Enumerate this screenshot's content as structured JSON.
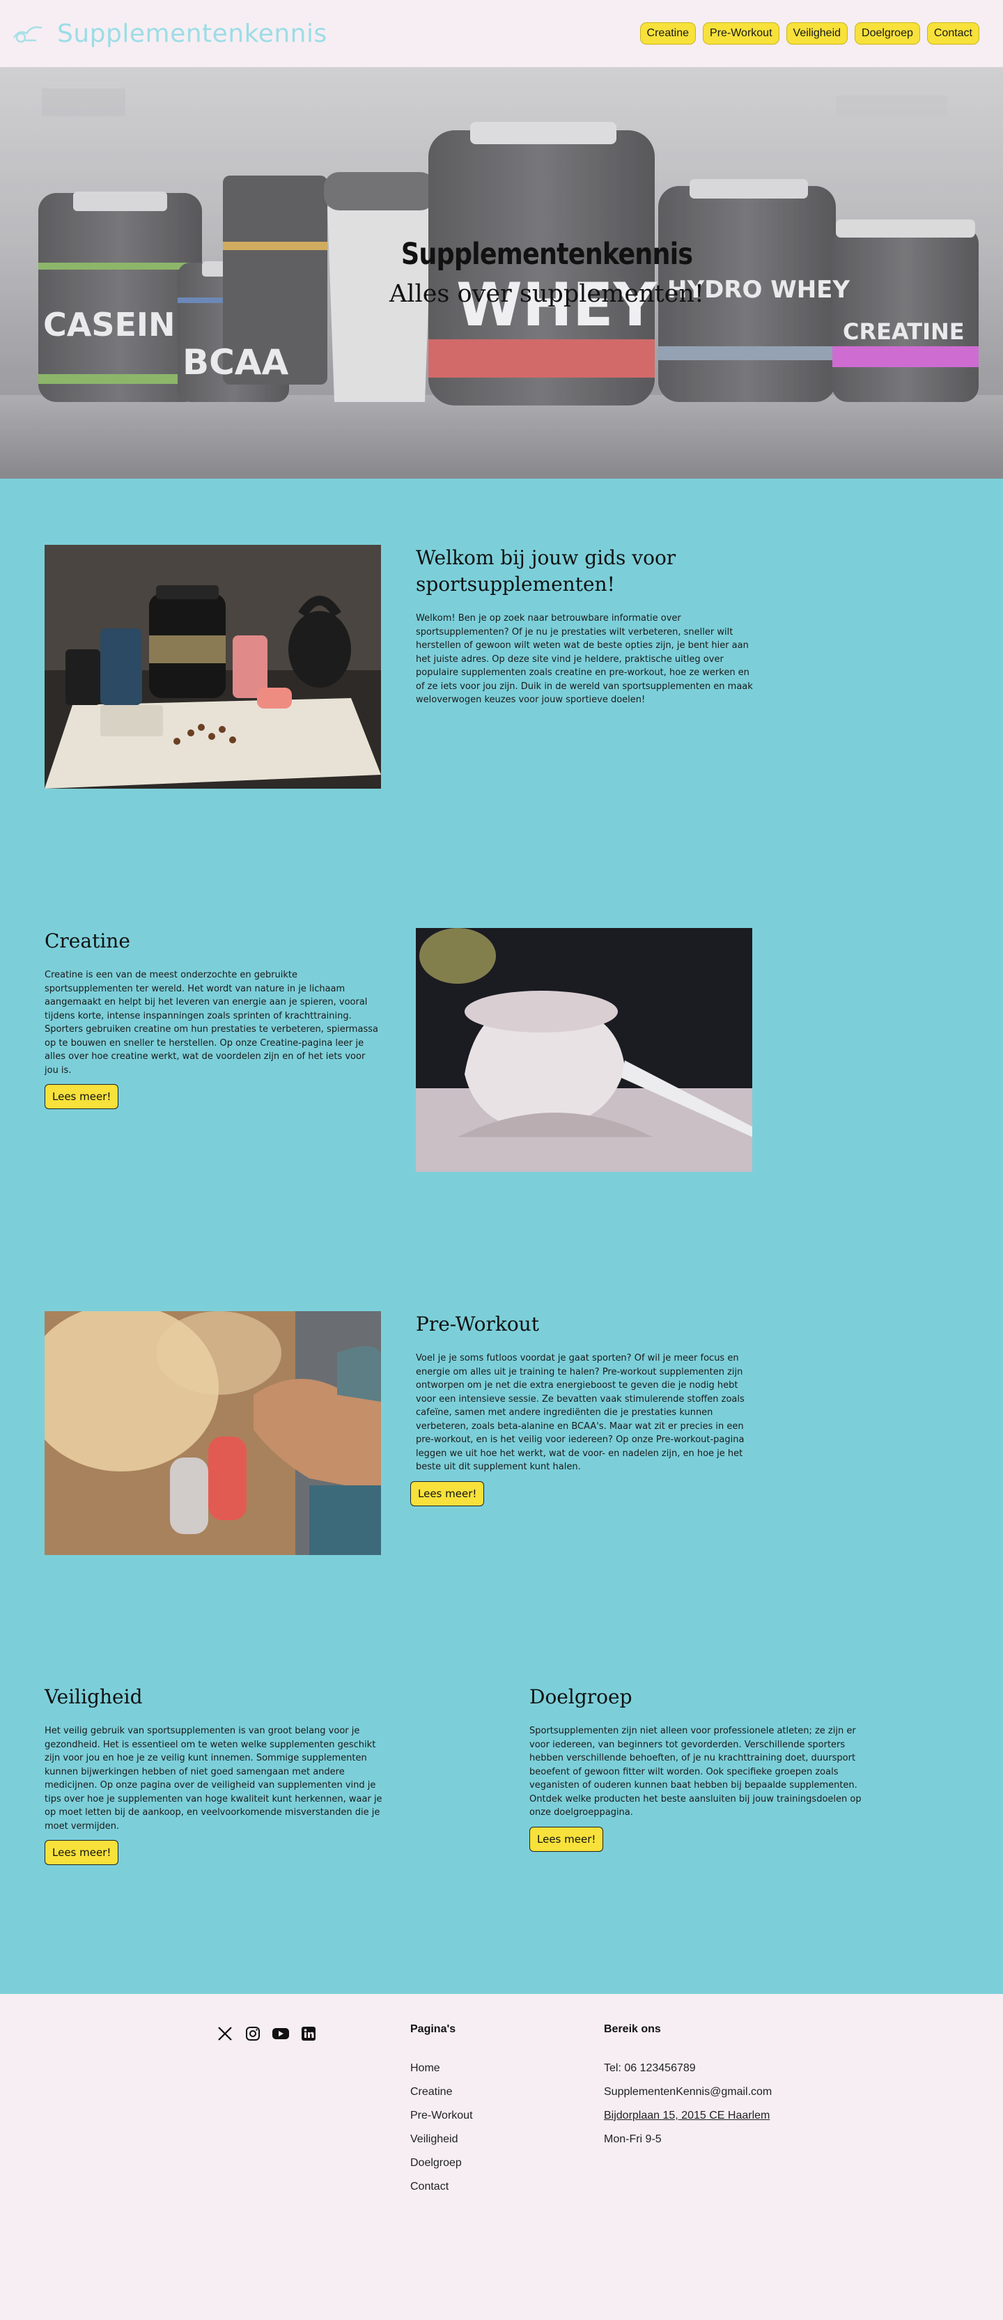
{
  "header": {
    "brand": "Supplementenkennis",
    "nav": [
      "Creatine",
      "Pre-Workout",
      "Veiligheid",
      "Doelgroep",
      "Contact"
    ]
  },
  "hero": {
    "title": "Supplementenkennis",
    "subtitle": "Alles over supplementen!",
    "tubs": [
      "CASEIN",
      "BCAA",
      "WHEY",
      "HYDRO WHEY",
      "CREATINE"
    ]
  },
  "intro": {
    "title": "Welkom bij jouw gids voor sportsupplementen!",
    "body": "Welkom! Ben je op zoek naar betrouwbare informatie over sportsupplementen? Of je nu je prestaties wilt verbeteren, sneller wilt herstellen of gewoon wilt weten wat de beste opties zijn, je bent hier aan het juiste adres. Op deze site vind je heldere, praktische uitleg over populaire supplementen zoals creatine en pre-workout, hoe ze werken en of ze iets voor jou zijn. Duik in de wereld van sportsupplementen en maak weloverwogen keuzes voor jouw sportieve doelen!"
  },
  "creatine": {
    "title": "Creatine",
    "body": "Creatine is een van de meest onderzochte en gebruikte sportsupplementen ter wereld. Het wordt van nature in je lichaam aangemaakt en helpt bij het leveren van energie aan je spieren, vooral tijdens korte, intense inspanningen zoals sprinten of krachttraining. Sporters gebruiken creatine om hun prestaties te verbeteren, spiermassa op te bouwen en sneller te herstellen. Op onze Creatine-pagina leer je alles over hoe creatine werkt, wat de voordelen zijn en of het iets voor jou is.",
    "button": "Lees meer!"
  },
  "preworkout": {
    "title": "Pre-Workout",
    "body": "Voel je je soms futloos voordat je gaat sporten? Of wil je meer focus en energie om alles uit je training te halen? Pre-workout supplementen zijn ontworpen om je net die extra energieboost te geven die je nodig hebt voor een intensieve sessie. Ze bevatten vaak stimulerende stoffen zoals cafeïne, samen met andere ingrediënten die je prestaties kunnen verbeteren, zoals beta-alanine en BCAA's. Maar wat zit er precies in een pre-workout, en is het veilig voor iedereen? Op onze Pre-workout-pagina leggen we uit hoe het werkt, wat de voor- en nadelen zijn, en hoe je het beste uit dit supplement kunt halen.",
    "button": "Lees meer!"
  },
  "veiligheid": {
    "title": "Veiligheid",
    "body": "Het veilig gebruik van sportsupplementen is van groot belang voor je gezondheid. Het is essentieel om te weten welke supplementen geschikt zijn voor jou en hoe je ze veilig kunt innemen. Sommige supplementen kunnen bijwerkingen hebben of niet goed samengaan met andere medicijnen. Op onze pagina over de veiligheid van supplementen vind je tips over hoe je supplementen van hoge kwaliteit kunt herkennen, waar je op moet letten bij de aankoop, en veelvoorkomende misverstanden die je moet vermijden.",
    "button": "Lees meer!"
  },
  "doelgroep": {
    "title": "Doelgroep",
    "body": "Sportsupplementen zijn niet alleen voor professionele atleten; ze zijn er voor iedereen, van beginners tot gevorderden. Verschillende sporters hebben verschillende behoeften, of je nu krachttraining doet, duursport beoefent of gewoon fitter wilt worden. Ook specifieke groepen zoals veganisten of ouderen kunnen baat hebben bij bepaalde supplementen. Ontdek welke producten het beste aansluiten bij jouw trainingsdoelen op onze doelgroeppagina.",
    "button": "Lees meer!"
  },
  "footer": {
    "pages_heading": "Pagina's",
    "pages": [
      "Home",
      "Creatine",
      "Pre-Workout",
      "Veiligheid",
      "Doelgroep",
      "Contact"
    ],
    "contact_heading": "Bereik ons",
    "phone": "Tel: 06 123456789",
    "email": "SupplementenKennis@gmail.com",
    "address": "Bijdorplaan 15, 2015 CE Haarlem",
    "hours": "Mon-Fri 9-5",
    "social": [
      "x-icon",
      "instagram-icon",
      "youtube-icon",
      "linkedin-icon"
    ]
  }
}
